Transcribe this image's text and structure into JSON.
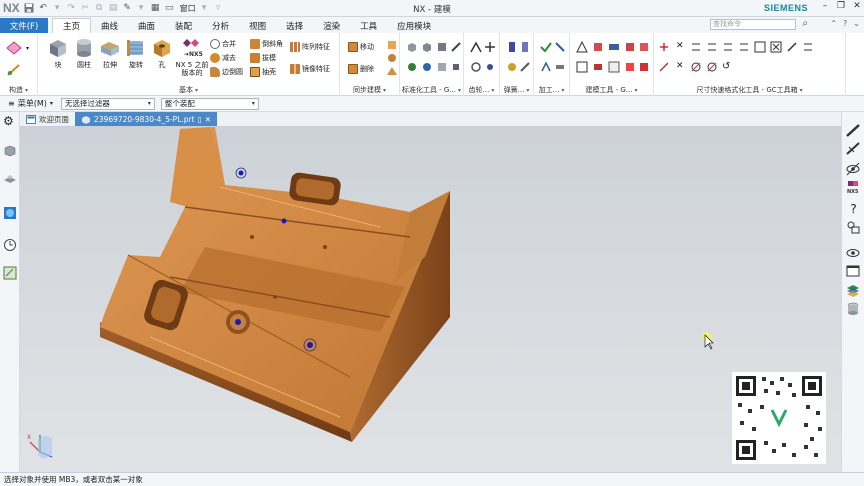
{
  "titlebar": {
    "app_logo": "NX",
    "window_menu": "窗口",
    "title": "NX - 建模",
    "brand": "SIEMENS"
  },
  "menutabs": {
    "file": "文件(F)",
    "tabs": [
      "主页",
      "曲线",
      "曲面",
      "装配",
      "分析",
      "视图",
      "选择",
      "渲染",
      "工具",
      "应用模块"
    ],
    "search_placeholder": "查找命令"
  },
  "ribbon": {
    "groups": {
      "sketch": {
        "label": "构造"
      },
      "basic": {
        "label": "基本",
        "big": [
          "块",
          "圆柱",
          "拉伸",
          "旋转",
          "孔"
        ],
        "nx5": "NX 5 之前版本的",
        "small": [
          "合并",
          "减去",
          "边倒圆",
          "倒斜角",
          "拔模",
          "抽壳"
        ],
        "pattern": "阵列特征",
        "mirror": "镜像特征"
      },
      "sync": {
        "label": "同步建模",
        "move": "移动",
        "delete": "删除"
      },
      "std": {
        "label": "标准化工具 - G..."
      },
      "gear": {
        "label": "齿轮..."
      },
      "spring": {
        "label": "弹簧..."
      },
      "machining": {
        "label": "加工..."
      },
      "modeling": {
        "label": "建模工具 - G..."
      },
      "dim": {
        "label": "尺寸快速格式化工具 - GC工具箱"
      }
    }
  },
  "filterbar": {
    "menu": "菜单(M)",
    "filter": "无选择过滤器",
    "assembly": "整个装配"
  },
  "doctabs": {
    "welcome": "欢迎页面",
    "part": "23969720-9830-4_5-PL.prt"
  },
  "statusbar": {
    "message": "选择对象并使用 MB3，或者双击某一对象"
  },
  "colors": {
    "accent": "#2b79c2",
    "part_tab": "#4a88c8",
    "model_body": "#c57a35",
    "model_dark": "#8c4e1e",
    "hole_blue": "#1a1ab0",
    "brand": "#17889a"
  }
}
